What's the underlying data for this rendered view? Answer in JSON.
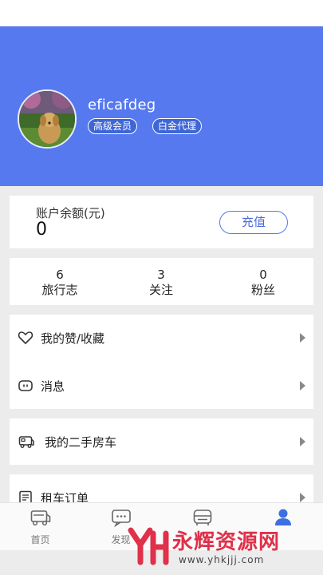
{
  "profile": {
    "username": "eficafdeg",
    "badges": [
      "高级会员",
      "白金代理"
    ]
  },
  "balance": {
    "label": "账户余额(元)",
    "value": "0",
    "recharge_label": "充值"
  },
  "stats": [
    {
      "count": "6",
      "label": "旅行志"
    },
    {
      "count": "3",
      "label": "关注"
    },
    {
      "count": "0",
      "label": "粉丝"
    }
  ],
  "menu": [
    {
      "label": "我的赞/收藏",
      "icon": "heart-icon"
    },
    {
      "label": "消息",
      "icon": "message-icon"
    },
    {
      "label": "我的二手房车",
      "icon": "rv-icon"
    },
    {
      "label": "租车订单",
      "icon": "order-list-icon"
    }
  ],
  "tabbar": [
    {
      "label": "首页",
      "icon": "rv-bus-icon"
    },
    {
      "label": "发现",
      "icon": "chat-bubble-icon"
    },
    {
      "label": "",
      "icon": "rv-front-icon"
    },
    {
      "label": "",
      "icon": "user-icon",
      "active": true
    }
  ],
  "watermark": {
    "text": "永辉资源网",
    "url": "www.yhkjjj.com"
  },
  "colors": {
    "primary": "#5679f0",
    "background": "#ececec",
    "watermark": "#e0304a"
  }
}
